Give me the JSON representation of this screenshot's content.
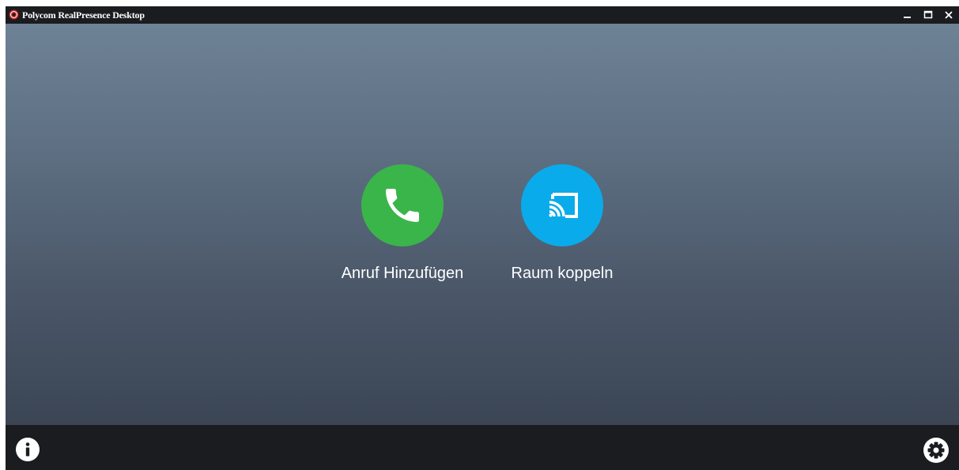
{
  "window": {
    "title": "Polycom RealPresence Desktop",
    "controls": {
      "minimize_icon": "minimize-icon",
      "maximize_icon": "maximize-icon",
      "close_icon": "close-icon"
    }
  },
  "actions": [
    {
      "label": "Anruf Hinzufügen",
      "icon": "phone-icon",
      "color": "#3ab54a"
    },
    {
      "label": "Raum koppeln",
      "icon": "cast-icon",
      "color": "#0aabea"
    }
  ],
  "footer": {
    "left_icon": "info-icon",
    "right_icon": "settings-gear-icon"
  },
  "colors": {
    "titlebar": "#1b1c1f",
    "gradient_top": "#6e8296",
    "gradient_bottom": "#3b4554",
    "accent_green": "#3ab54a",
    "accent_blue": "#0aabea"
  }
}
